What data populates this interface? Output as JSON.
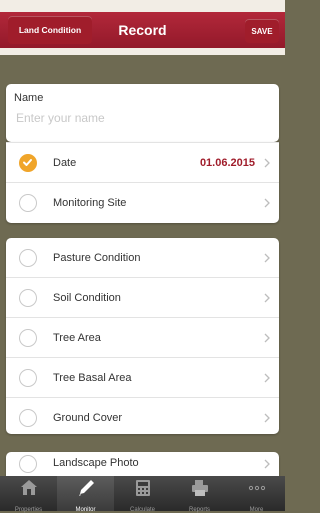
{
  "header": {
    "back_label": "Land Condition",
    "title": "Record",
    "save_label": "SAVE"
  },
  "name_panel": {
    "label": "Name",
    "placeholder": "Enter your name"
  },
  "group1": [
    {
      "label": "Date",
      "value": "01.06.2015",
      "checked": true
    },
    {
      "label": "Monitoring Site",
      "value": "",
      "checked": false
    }
  ],
  "group2": [
    {
      "label": "Pasture Condition"
    },
    {
      "label": "Soil Condition"
    },
    {
      "label": "Tree Area"
    },
    {
      "label": "Tree Basal Area"
    },
    {
      "label": "Ground Cover"
    }
  ],
  "group3": [
    {
      "label": "Landscape Photo"
    }
  ],
  "tabs": [
    {
      "label": "Properties",
      "icon": "home-icon"
    },
    {
      "label": "Monitor",
      "icon": "pencil-icon",
      "active": true
    },
    {
      "label": "Calculate",
      "icon": "calculator-icon"
    },
    {
      "label": "Reports",
      "icon": "printer-icon"
    },
    {
      "label": "More",
      "icon": "more-icon"
    }
  ],
  "colors": {
    "accent": "#a01d2b",
    "check": "#f0a52a"
  }
}
